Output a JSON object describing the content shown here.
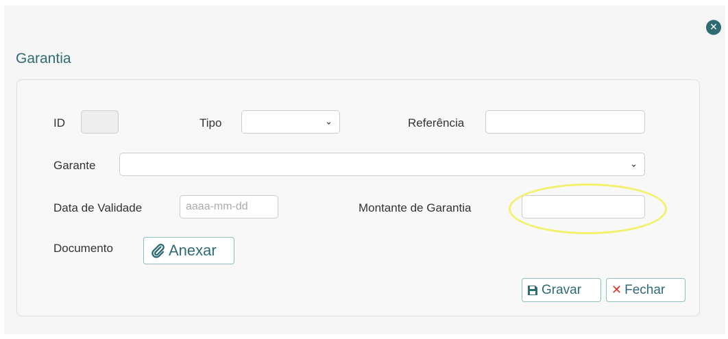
{
  "dialog": {
    "title": "Garantia",
    "close_icon": "times-circle-icon"
  },
  "form": {
    "id": {
      "label": "ID",
      "value": ""
    },
    "tipo": {
      "label": "Tipo",
      "selected": ""
    },
    "referencia": {
      "label": "Referência",
      "value": ""
    },
    "garante": {
      "label": "Garante",
      "selected": ""
    },
    "data_validade": {
      "label": "Data de Validade",
      "placeholder": "aaaa-mm-dd",
      "value": ""
    },
    "montante_garantia": {
      "label": "Montante de Garantia",
      "value": ""
    },
    "documento": {
      "label": "Documento",
      "attach_label": "Anexar",
      "attach_icon": "paperclip-icon"
    }
  },
  "actions": {
    "save_label": "Gravar",
    "save_icon": "floppy-disk-icon",
    "close_label": "Fechar",
    "close_icon": "times-icon"
  },
  "colors": {
    "accent": "#2f6b73",
    "button_border": "#8fbcbc",
    "close_x": "#e0332a",
    "highlight": "#f3f06a"
  }
}
